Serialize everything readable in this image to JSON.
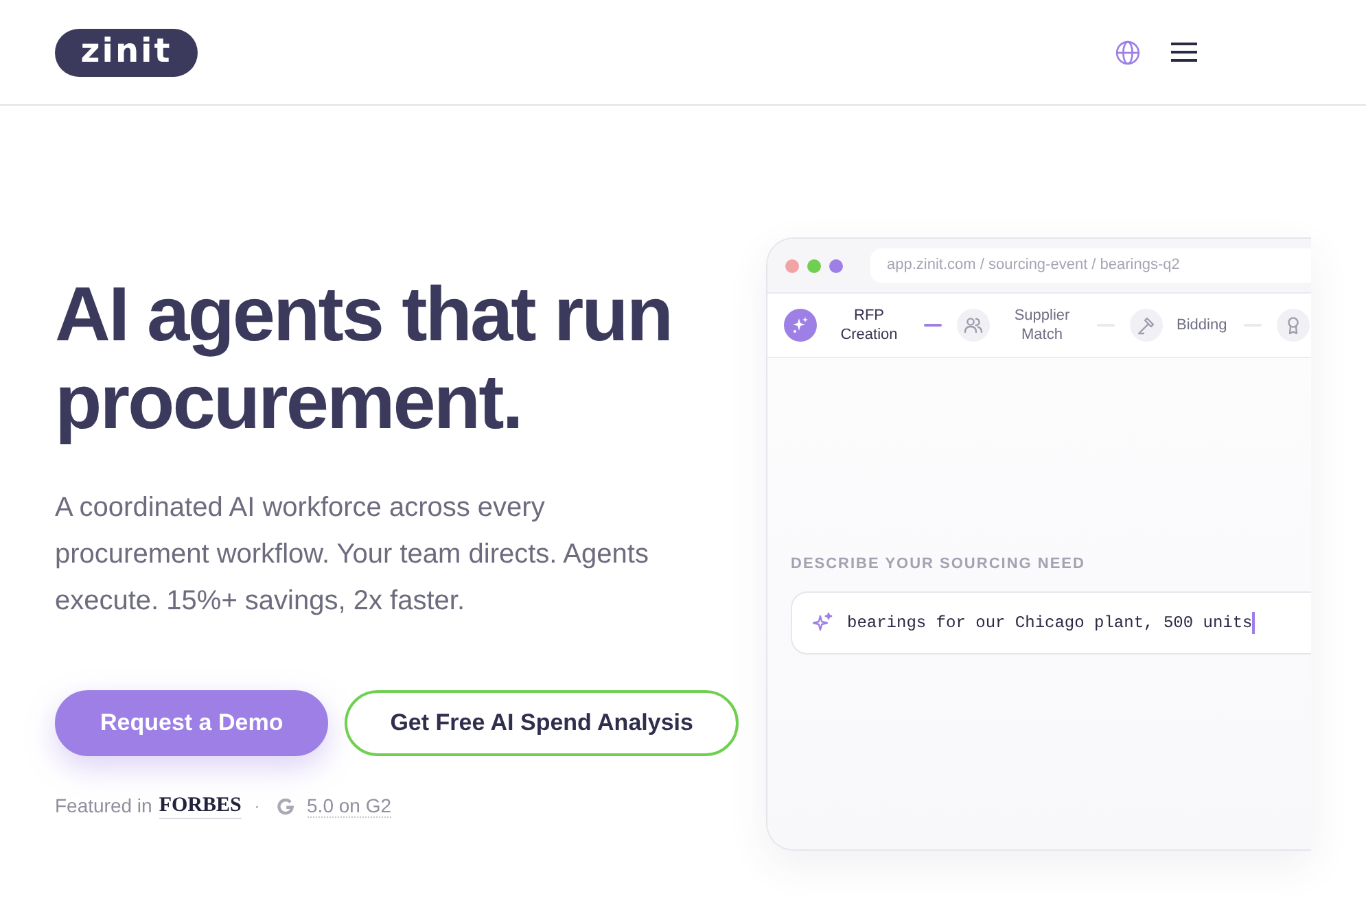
{
  "header": {
    "logo": "zinit"
  },
  "hero": {
    "headline": "AI agents that run procurement.",
    "subtitle": "A coordinated AI workforce across every procurement workflow. Your team directs. Agents execute. 15%+ savings, 2x faster.",
    "buttons": [
      {
        "label": "Request a Demo",
        "kind": "primary"
      },
      {
        "label": "Get Free AI Spend Analysis",
        "kind": "outline"
      }
    ],
    "social_proof": {
      "featured_label": "Featured in",
      "publication": "FORBES",
      "separator": "·",
      "rating": "5.0 on G2"
    }
  },
  "app_preview": {
    "url": "app.zinit.com / sourcing-event / bearings-q2",
    "steps": [
      {
        "label": "RFP Creation",
        "active": true
      },
      {
        "label": "Supplier Match",
        "active": false
      },
      {
        "label": "Bidding",
        "active": false
      },
      {
        "active": false
      }
    ],
    "prompt": {
      "label": "DESCRIBE YOUR SOURCING NEED",
      "value": "bearings for our Chicago plant, 500 units",
      "focused": true
    }
  }
}
